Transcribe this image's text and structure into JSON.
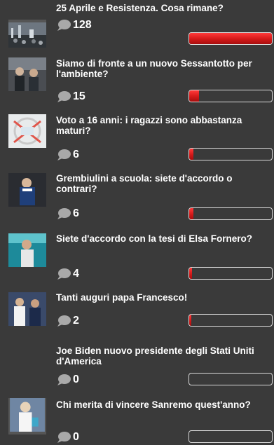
{
  "colors": {
    "background": "#3a3a3a",
    "bar_fill": "#d81b1b",
    "bar_border": "#d9d9d9",
    "text": "#ffffff"
  },
  "items": [
    {
      "title": "25 Aprile e Resistenza. Cosa rimane?",
      "count": "128",
      "share": 1.0,
      "has_thumb": true,
      "thumb_icon": "crowd-photo"
    },
    {
      "title": "Siamo di fronte a un nuovo Sessantotto per l'ambiente?",
      "count": "15",
      "share": 0.117,
      "has_thumb": true,
      "thumb_icon": "protest-photo"
    },
    {
      "title": "Voto a 16 anni: i ragazzi sono abbastanza maturi?",
      "count": "6",
      "share": 0.047,
      "has_thumb": true,
      "thumb_icon": "ballot-photo"
    },
    {
      "title": "Grembiulini a scuola: siete d'accordo o contrari?",
      "count": "6",
      "share": 0.047,
      "has_thumb": true,
      "thumb_icon": "child-photo"
    },
    {
      "title": "Siete d'accordo con la tesi di Elsa Fornero?",
      "count": "4",
      "share": 0.031,
      "has_thumb": true,
      "thumb_icon": "speaker-photo"
    },
    {
      "title": "Tanti auguri papa Francesco!",
      "count": "2",
      "share": 0.016,
      "has_thumb": true,
      "thumb_icon": "pope-photo"
    },
    {
      "title": "Joe Biden nuovo presidente degli Stati Uniti d'America",
      "count": "0",
      "share": 0.0,
      "has_thumb": false,
      "thumb_icon": ""
    },
    {
      "title": "Chi merita di vincere Sanremo quest'anno?",
      "count": "0",
      "share": 0.0,
      "has_thumb": true,
      "thumb_icon": "singer-photo"
    }
  ]
}
